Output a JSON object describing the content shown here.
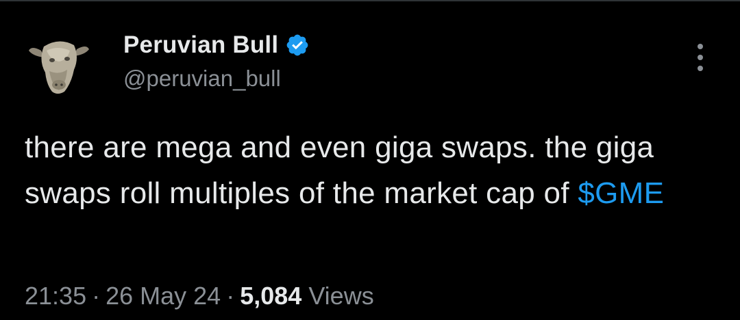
{
  "tweet": {
    "author": {
      "display_name": "Peruvian Bull",
      "handle": "@peruvian_bull",
      "verified": true,
      "avatar_icon": "bull-head-statue-icon"
    },
    "text_parts": {
      "before_cashtag": "there are mega and even giga swaps. the giga swaps roll multiples of the market cap of ",
      "cashtag": "$GME"
    },
    "meta": {
      "time": "21:35",
      "separator": "·",
      "date": "26 May 24",
      "view_count": "5,084",
      "views_label": "Views"
    },
    "more_icon": "more-vertical-icon"
  },
  "colors": {
    "background": "#000000",
    "text_primary": "#e7e9ea",
    "text_secondary": "#8b9096",
    "accent": "#1d9bf0"
  }
}
